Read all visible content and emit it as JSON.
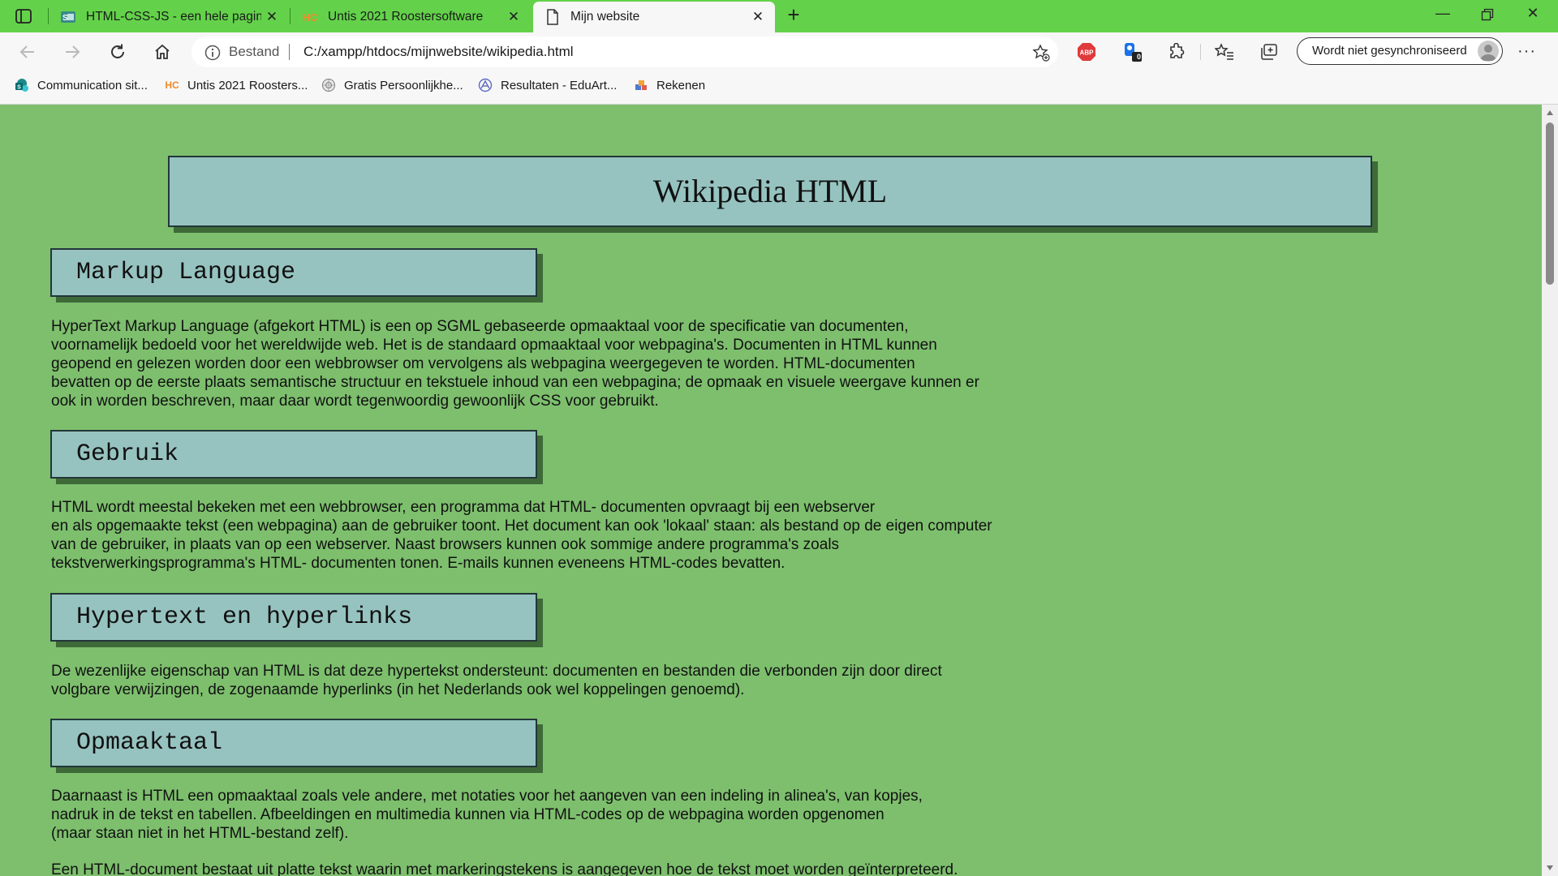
{
  "browser": {
    "tabs": [
      {
        "label": "HTML-CSS-JS - een hele pagina"
      },
      {
        "label": "Untis 2021 Roostersoftware"
      },
      {
        "label": "Mijn website"
      }
    ],
    "address": {
      "security_label": "Bestand",
      "url": "C:/xampp/htdocs/mijnwebsite/wikipedia.html"
    },
    "extension_badge": "0",
    "adblock_label": "ABP",
    "sync_label": "Wordt niet gesynchroniseerd",
    "bookmarks": [
      {
        "label": "Communication sit..."
      },
      {
        "label": "Untis 2021 Roosters..."
      },
      {
        "label": "Gratis Persoonlijkhe..."
      },
      {
        "label": "Resultaten - EduArt..."
      },
      {
        "label": "Rekenen"
      }
    ]
  },
  "page": {
    "title": "Wikipedia HTML",
    "sections": [
      {
        "heading": "Markup Language",
        "lines": [
          "HyperText Markup Language (afgekort HTML) is een op SGML gebaseerde opmaaktaal voor de specificatie van documenten,",
          "voornamelijk bedoeld voor het wereldwijde web. Het is de standaard opmaaktaal voor webpagina's. Documenten in HTML kunnen",
          "geopend en gelezen worden door een webbrowser om vervolgens als webpagina weergegeven te worden. HTML-documenten",
          "bevatten op de eerste plaats semantische structuur en tekstuele inhoud van een webpagina; de opmaak en visuele weergave kunnen er",
          "ook in worden beschreven, maar daar wordt tegenwoordig gewoonlijk CSS voor gebruikt."
        ]
      },
      {
        "heading": "Gebruik",
        "lines": [
          "HTML wordt meestal bekeken met een webbrowser, een programma dat HTML- documenten opvraagt bij een webserver",
          "en als opgemaakte tekst (een webpagina) aan de gebruiker toont. Het document kan ook 'lokaal' staan: als bestand op de eigen computer",
          "van de gebruiker, in plaats van op een webserver. Naast browsers kunnen ook sommige andere programma's zoals",
          "tekstverwerkingsprogramma's HTML- documenten tonen. E-mails kunnen eveneens HTML-codes bevatten."
        ]
      },
      {
        "heading": "Hypertext en hyperlinks",
        "lines": [
          "De wezenlijke eigenschap van HTML is dat deze hypertekst ondersteunt: documenten en bestanden die verbonden zijn door direct",
          "volgbare verwijzingen, de zogenaamde hyperlinks (in het Nederlands ook wel koppelingen genoemd)."
        ]
      },
      {
        "heading": "Opmaaktaal",
        "lines": [
          "Daarnaast is HTML een opmaaktaal zoals vele andere, met notaties voor het aangeven van een indeling in alinea's, van kopjes,",
          "nadruk in de tekst en tabellen. Afbeeldingen en multimedia kunnen via HTML-codes op de webpagina worden opgenomen",
          "(maar staan niet in het HTML-bestand zelf)."
        ],
        "lines2": [
          "Een HTML-document bestaat uit platte tekst waarin met markeringstekens is aangegeven hoe de tekst moet worden geïnterpreteerd."
        ]
      }
    ]
  }
}
